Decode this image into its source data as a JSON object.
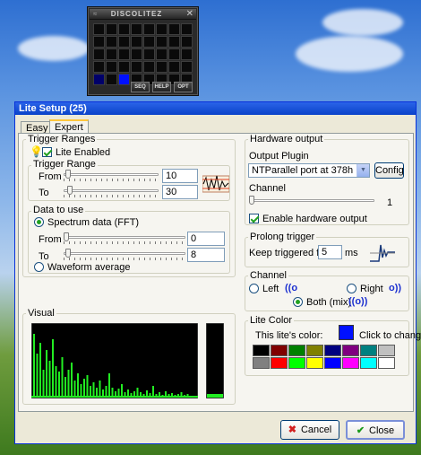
{
  "discolitez": {
    "title": "DISCOLITEZ",
    "buttons": [
      "SEQ",
      "HELP",
      "OPT"
    ]
  },
  "dialog": {
    "title": "Lite Setup (25)",
    "tabs": [
      "Easy",
      "Expert"
    ],
    "active_tab": "Expert"
  },
  "trigger_ranges": {
    "group": "Trigger Ranges",
    "lite_enabled": "Lite Enabled",
    "range_group": "Trigger Range",
    "from_label": "From",
    "to_label": "To",
    "from_value": "10",
    "to_value": "30"
  },
  "data_to_use": {
    "group": "Data to use",
    "spectrum": "Spectrum data (FFT)",
    "from_label": "From",
    "to_label": "To",
    "from_value": "0",
    "to_value": "8",
    "waveform": "Waveform average"
  },
  "visual": {
    "group": "Visual"
  },
  "hardware": {
    "group": "Hardware output",
    "plugin_label": "Output Plugin",
    "plugin_value": "NTParallel port at 378h",
    "config": "Config",
    "channel_label": "Channel",
    "channel_value": "1",
    "enable": "Enable hardware output"
  },
  "prolong": {
    "group": "Prolong trigger",
    "keep_label": "Keep triggered for",
    "value": "5",
    "unit": "ms"
  },
  "channel": {
    "group": "Channel",
    "left": "Left",
    "right": "Right",
    "both": "Both (mix)",
    "left_sym": "((o",
    "right_sym": "o))",
    "both_sym": "((o))"
  },
  "lite_color": {
    "group": "Lite Color",
    "label": "This lite's color:",
    "click": "Click to change",
    "current": "#0010ff",
    "palette": [
      "#000000",
      "#800000",
      "#008000",
      "#808000",
      "#000080",
      "#800080",
      "#008080",
      "#c0c0c0",
      "#808080",
      "#ff0000",
      "#00ff00",
      "#ffff00",
      "#0000ff",
      "#ff00ff",
      "#00ffff",
      "#ffffff"
    ]
  },
  "footer": {
    "cancel": "Cancel",
    "close": "Close"
  }
}
